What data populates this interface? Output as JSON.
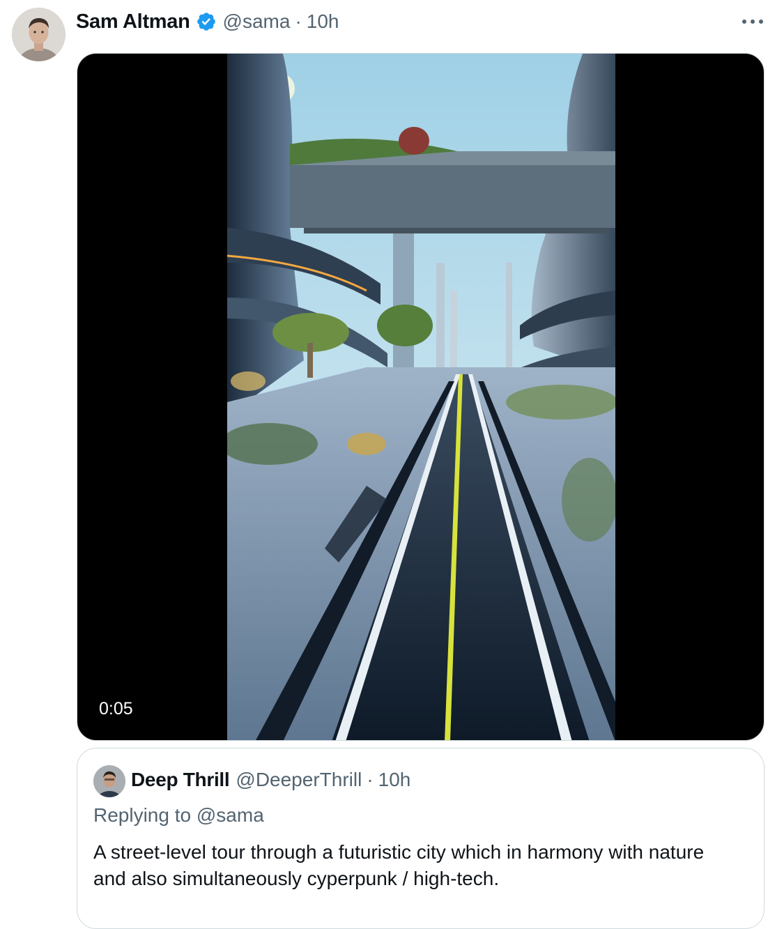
{
  "tweet": {
    "display_name": "Sam Altman",
    "handle": "@sama",
    "separator": "·",
    "time": "10h",
    "verified_icon": "verified-badge-icon",
    "more_icon": "more-options-icon",
    "video": {
      "duration": "0:05"
    }
  },
  "quoted": {
    "display_name": "Deep Thrill",
    "handle": "@DeeperThrill",
    "separator": "·",
    "time": "10h",
    "replying_prefix": "Replying to",
    "replying_handle": "@sama",
    "text": "A street-level tour through a futuristic city which in harmony with nature and also simultaneously cyperpunk / high-tech."
  },
  "colors": {
    "text_primary": "#0f1419",
    "text_secondary": "#536471",
    "verified": "#1d9bf0",
    "border": "#cfd9de"
  }
}
